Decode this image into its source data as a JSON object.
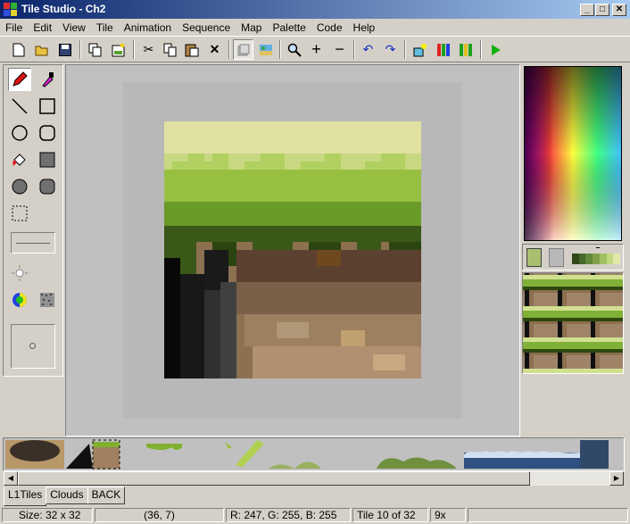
{
  "window": {
    "title": "Tile Studio - Ch2",
    "minimize": "_",
    "maximize": "□",
    "close": "✕"
  },
  "menu": [
    "File",
    "Edit",
    "View",
    "Tile",
    "Animation",
    "Sequence",
    "Map",
    "Palette",
    "Code",
    "Help"
  ],
  "toolbar": {
    "icons": [
      "new-file-icon",
      "open-folder-icon",
      "save-icon",
      "copy-tiles-icon",
      "tile-image-icon",
      "cut-icon",
      "copy-icon",
      "paste-icon",
      "delete-icon",
      "layer-icon",
      "import-icon",
      "zoom-icon",
      "zoom-in-icon",
      "zoom-out-icon",
      "undo-icon",
      "redo-icon",
      "lightbulb-icon",
      "palette-bars-icon",
      "color-bars-icon",
      "play-icon"
    ]
  },
  "tools": [
    "pencil",
    "dropper",
    "line",
    "rectangle",
    "circle",
    "rounded-rect",
    "fill",
    "filled-rect",
    "filled-circle",
    "filled-rounded-rect",
    "select",
    "line-style",
    "light",
    "darken",
    "color-cycle",
    "pattern",
    "brush-size"
  ],
  "tabs": {
    "items": [
      "L1Tiles",
      "Clouds",
      "BACK"
    ],
    "active": "L1Tiles"
  },
  "status": {
    "size": "Size: 32 x 32",
    "coords": "(36, 7)",
    "color": "R: 247, G: 255, B: 255",
    "tile": "Tile 10 of 32",
    "zoom": "9x"
  },
  "colors": {
    "title_start": "#0a246a",
    "title_end": "#a6caf0",
    "foreground": "#a8c070",
    "background": "#b8b8b8"
  }
}
